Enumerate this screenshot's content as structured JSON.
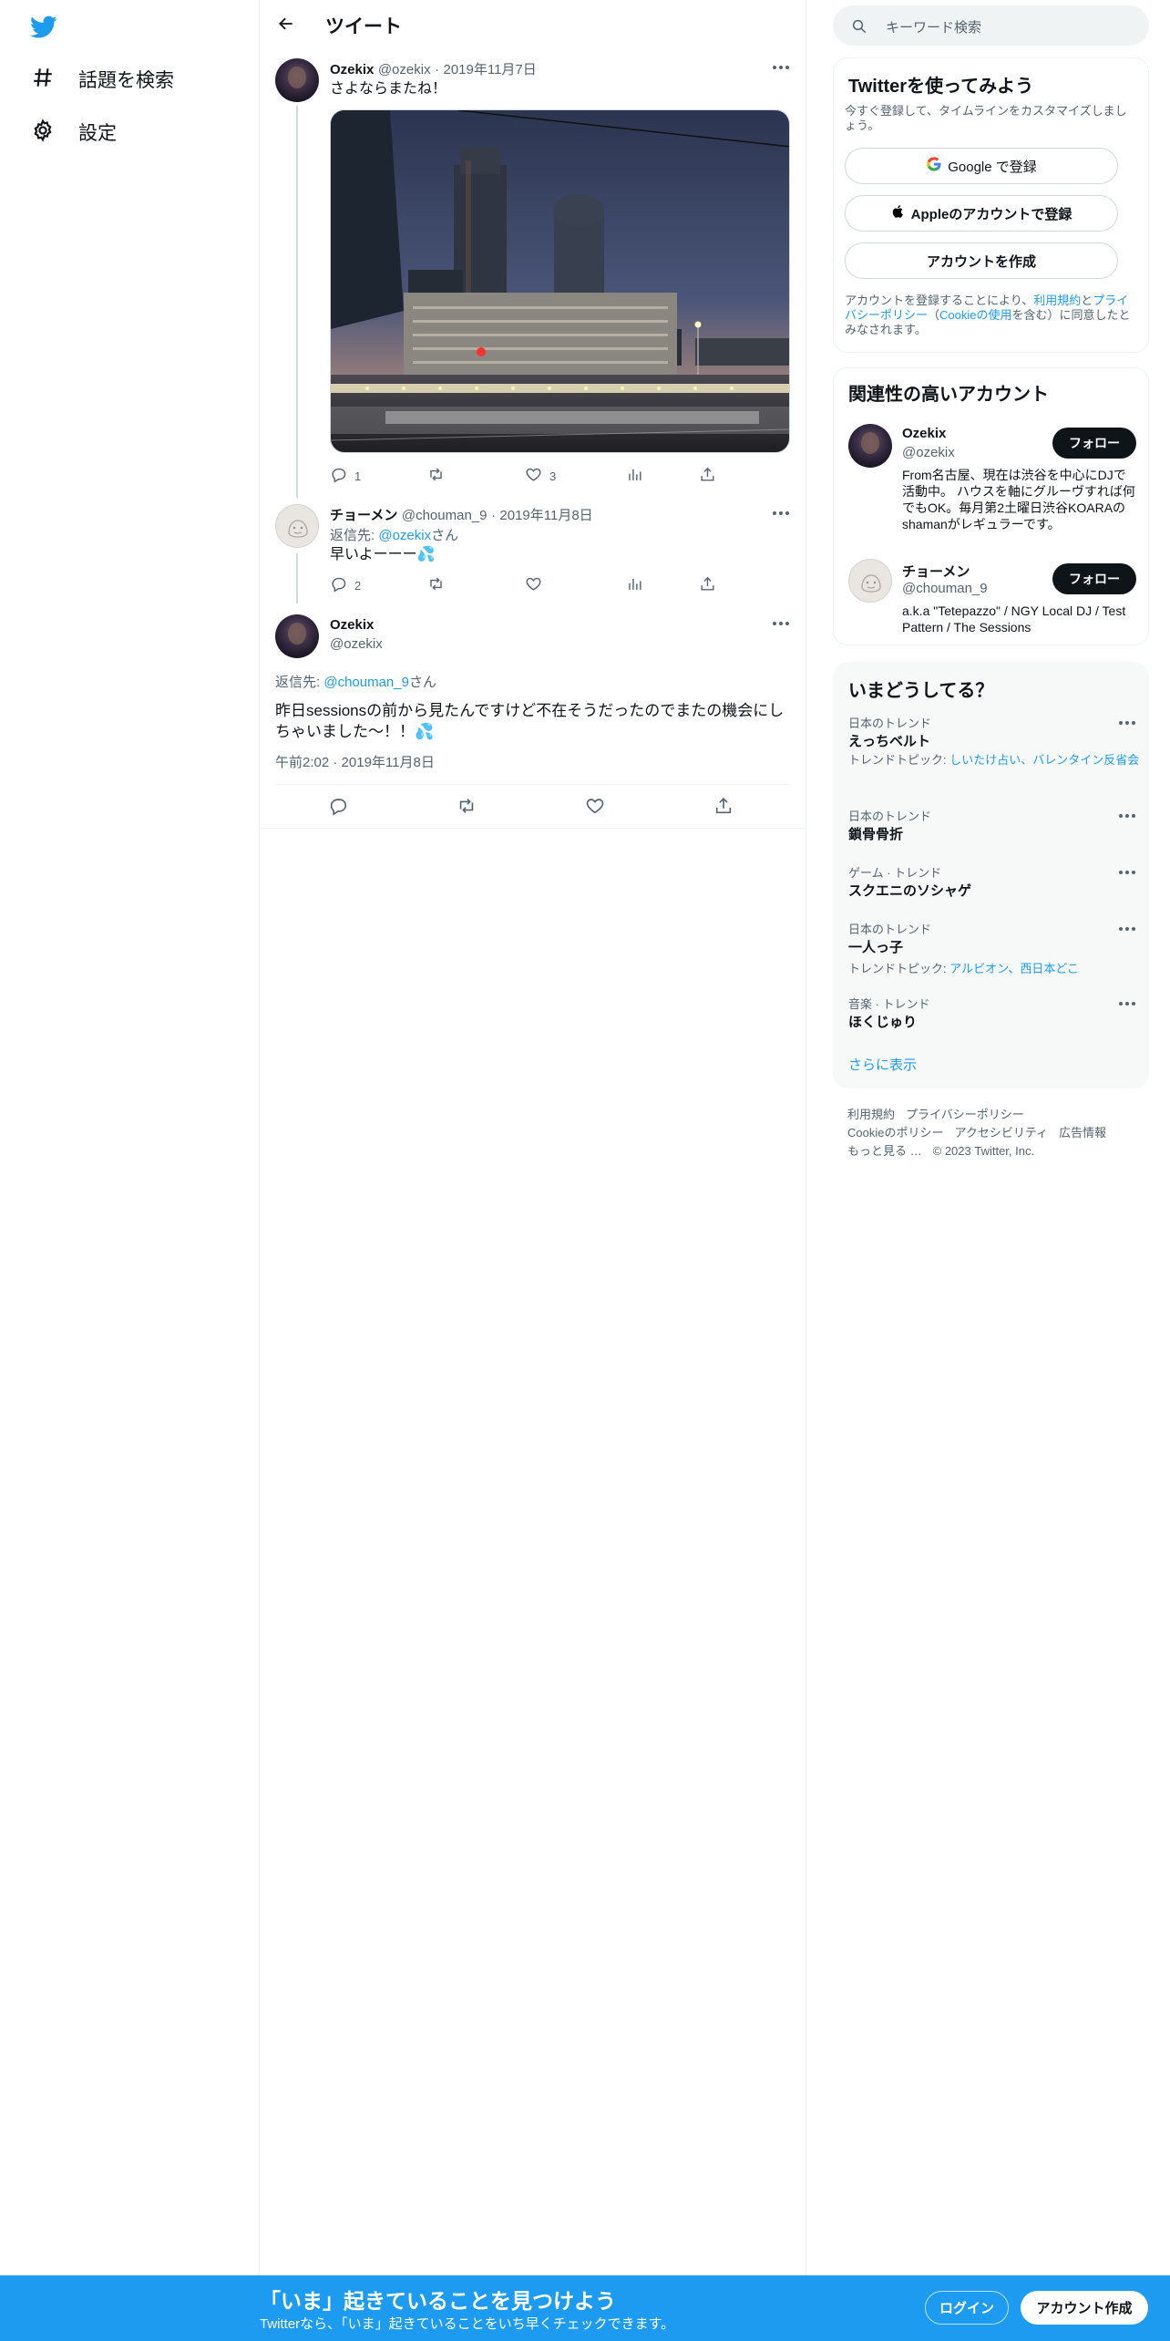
{
  "nav": {
    "explore_label": "話題を検索",
    "settings_label": "設定"
  },
  "header": {
    "title": "ツイート"
  },
  "tweets": [
    {
      "name": "Ozekix",
      "handle": "@ozekix",
      "date": "2019年11月7日",
      "text": "さよならまたね！",
      "reply_count": "1",
      "retweet_count": "",
      "like_count": "3"
    },
    {
      "name": "チョーメン",
      "handle": "@chouman_9",
      "date": "2019年11月8日",
      "reply_prefix": "返信先: ",
      "reply_to": "@ozekix",
      "reply_suffix": "さん",
      "text": "早いよーーー💦",
      "reply_count": "2"
    }
  ],
  "focused": {
    "name": "Ozekix",
    "handle": "@ozekix",
    "reply_prefix": "返信先: ",
    "reply_to": "@chouman_9",
    "reply_suffix": "さん",
    "text": "昨日sessionsの前から見たんですけど不在そうだったのでまたの機会にしちゃいました〜！！💦",
    "time": "午前2:02",
    "date": "2019年11月8日"
  },
  "search": {
    "placeholder": "キーワード検索"
  },
  "signup_card": {
    "title": "Twitterを使ってみよう",
    "subtitle": "今すぐ登録して、タイムラインをカスタマイズしましょう。",
    "google_label": "Google で登録",
    "apple_label": "Appleのアカウントで登録",
    "create_label": "アカウントを作成",
    "terms_prefix": "アカウントを登録することにより、",
    "terms_link": "利用規約",
    "terms_and": "と",
    "privacy_link": "プライバシーポリシー",
    "cookie_open": "（",
    "cookie_link": "Cookieの使用",
    "terms_suffix": "を含む）に同意したとみなされます。"
  },
  "relevant": {
    "title": "関連性の高いアカウント",
    "follow_label": "フォロー",
    "accounts": [
      {
        "name": "Ozekix",
        "handle": "@ozekix",
        "bio": "From名古屋、現在は渋谷を中心にDJで活動中。 ハウスを軸にグルーヴすれば何でもOK。毎月第2土曜日渋谷KOARAのshamanがレギュラーです。"
      },
      {
        "name": "チョーメン",
        "handle": "@chouman_9",
        "bio": "a.k.a \"Tetepazzo\" / NGY Local DJ / Test Pattern / The Sessions"
      }
    ]
  },
  "trends": {
    "title": "いまどうしてる？",
    "items": [
      {
        "context": "日本のトレンド",
        "name": "えっちベルト",
        "topic_prefix": "トレンドトピック: ",
        "topic": "しいたけ占い、バレンタイン反省会"
      },
      {
        "context": "日本のトレンド",
        "name": "鎖骨骨折",
        "topic_prefix": "",
        "topic": ""
      },
      {
        "context": "ゲーム · トレンド",
        "name": "スクエニのソシャゲ",
        "topic_prefix": "",
        "topic": ""
      },
      {
        "context": "日本のトレンド",
        "name": "一人っ子",
        "topic_prefix": "トレンドトピック: ",
        "topic": "アルビオン、西日本どこ"
      },
      {
        "context": "音楽 · トレンド",
        "name": "ほくじゅり",
        "topic_prefix": "",
        "topic": ""
      }
    ],
    "show_more": "さらに表示"
  },
  "footer": {
    "terms": "利用規約",
    "privacy": "プライバシーポリシー",
    "cookie": "Cookieのポリシー",
    "accessibility": "アクセシビリティ",
    "ads": "広告情報",
    "more": "もっと見る …",
    "copyright": "© 2023 Twitter, Inc."
  },
  "bottombar": {
    "title": "「いま」起きていることを見つけよう",
    "subtitle": "Twitterなら、「いま」起きていることをいち早くチェックできます。",
    "login_label": "ログイン",
    "signup_label": "アカウント作成"
  },
  "colors": {
    "brand_blue": "#1d9bf0",
    "text_primary": "#0f1419",
    "text_secondary": "#536471"
  }
}
